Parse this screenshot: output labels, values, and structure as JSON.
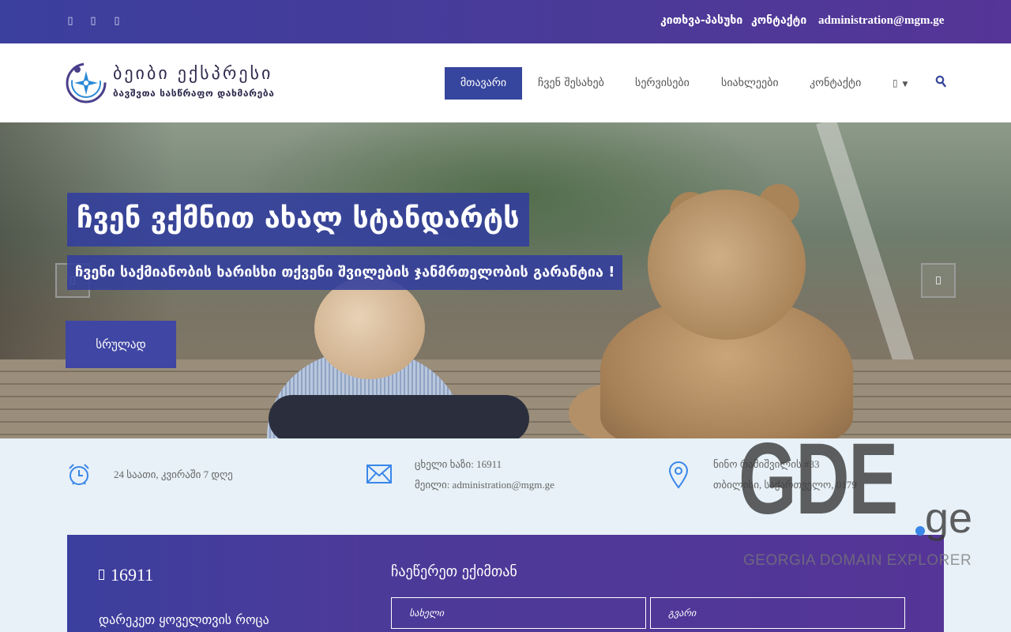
{
  "topbar": {
    "social_icons": [
      "facebook-icon",
      "twitter-icon",
      "instagram-icon"
    ],
    "faq_label": "კითხვა-პასუხი",
    "contact_label": "კონტაქტი",
    "email": "administration@mgm.ge"
  },
  "header": {
    "logo_title": "ბეიბი ექსპრესი",
    "logo_subtitle": "ბავშვთა სასწრაფო დახმარება",
    "nav": [
      {
        "label": "მთავარი",
        "active": true
      },
      {
        "label": "ჩვენ შესახებ"
      },
      {
        "label": "სერვისები"
      },
      {
        "label": "სიახლეები"
      },
      {
        "label": "კონტაქტი"
      }
    ],
    "language_icon": "flag-icon",
    "search_icon": "search-icon"
  },
  "hero": {
    "title": "ჩვენ ვქმნით ახალ სტანდარტს",
    "subtitle": "ჩვენი საქმიანობის ხარისხი თქვენი შვილების ჯანმრთელობის გარანტია !",
    "button_label": "სრულად",
    "prev_icon": "chevron-left-icon",
    "next_icon": "chevron-right-icon"
  },
  "info": {
    "hours": "24 საათი, კვირაში 7 დღე",
    "hotline": "ცხელი ხაზი: 16911",
    "mail": "მეილი: administration@mgm.ge",
    "address_line1": "ნინო რამიშვილის #33",
    "address_line2": "თბილისი, საქართველო, 0179"
  },
  "callout": {
    "phone": "16911",
    "text": "დარეკეთ ყოველთვის როცა"
  },
  "appointment": {
    "title": "ჩაეწერეთ ექიმთან",
    "name_placeholder": "სახელი",
    "surname_placeholder": "გვარი"
  },
  "watermark": {
    "brand": "GDE",
    "tld": "ge",
    "caption": "GEORGIA DOMAIN EXPLORER"
  },
  "colors": {
    "primary": "#36459d",
    "gradient_end": "#553597",
    "info_bg": "#e7f1f7",
    "icon_blue": "#3a86e8"
  }
}
